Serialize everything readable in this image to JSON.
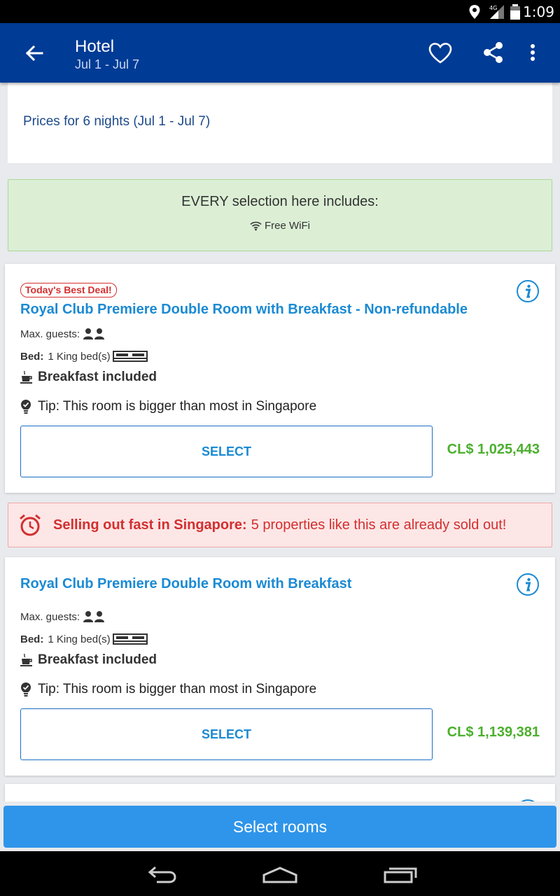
{
  "status_bar": {
    "time": "1:09",
    "network": "4G"
  },
  "app_bar": {
    "title": "Hotel",
    "subtitle": "Jul 1 - Jul 7",
    "icons": [
      "back-arrow-icon",
      "heart-icon",
      "share-icon",
      "more-vert-icon"
    ]
  },
  "prices": {
    "text": "Prices for 6 nights (Jul 1 - Jul 7)"
  },
  "includes": {
    "headline": "EVERY selection here includes:",
    "amenity": "Free WiFi"
  },
  "rooms": [
    {
      "badge": "Today's Best Deal!",
      "title": "Royal Club Premiere Double Room with Breakfast - Non-refundable",
      "max_guests_label": "Max. guests:",
      "bed_label": "Bed:",
      "bed_value": "1 King bed(s)",
      "breakfast": "Breakfast included",
      "tip": "Tip: This room is bigger than most in Singapore",
      "select_label": "SELECT",
      "price": "CL$ 1,025,443"
    },
    {
      "title": "Royal Club Premiere Double Room with Breakfast",
      "max_guests_label": "Max. guests:",
      "bed_label": "Bed:",
      "bed_value": "1 King bed(s)",
      "breakfast": "Breakfast included",
      "tip": "Tip: This room is bigger than most in Singapore",
      "select_label": "SELECT",
      "price": "CL$ 1,139,381"
    }
  ],
  "alert": {
    "bold": "Selling out fast in Singapore:",
    "text": "5 properties like this are already sold out!"
  },
  "bottom_button": {
    "label": "Select rooms"
  },
  "colors": {
    "app_bar": "#003b95",
    "link_blue": "#1b8ad3",
    "price_green": "#4caf2e",
    "alert_red": "#d32f2f",
    "button_blue": "#2f95ea"
  }
}
